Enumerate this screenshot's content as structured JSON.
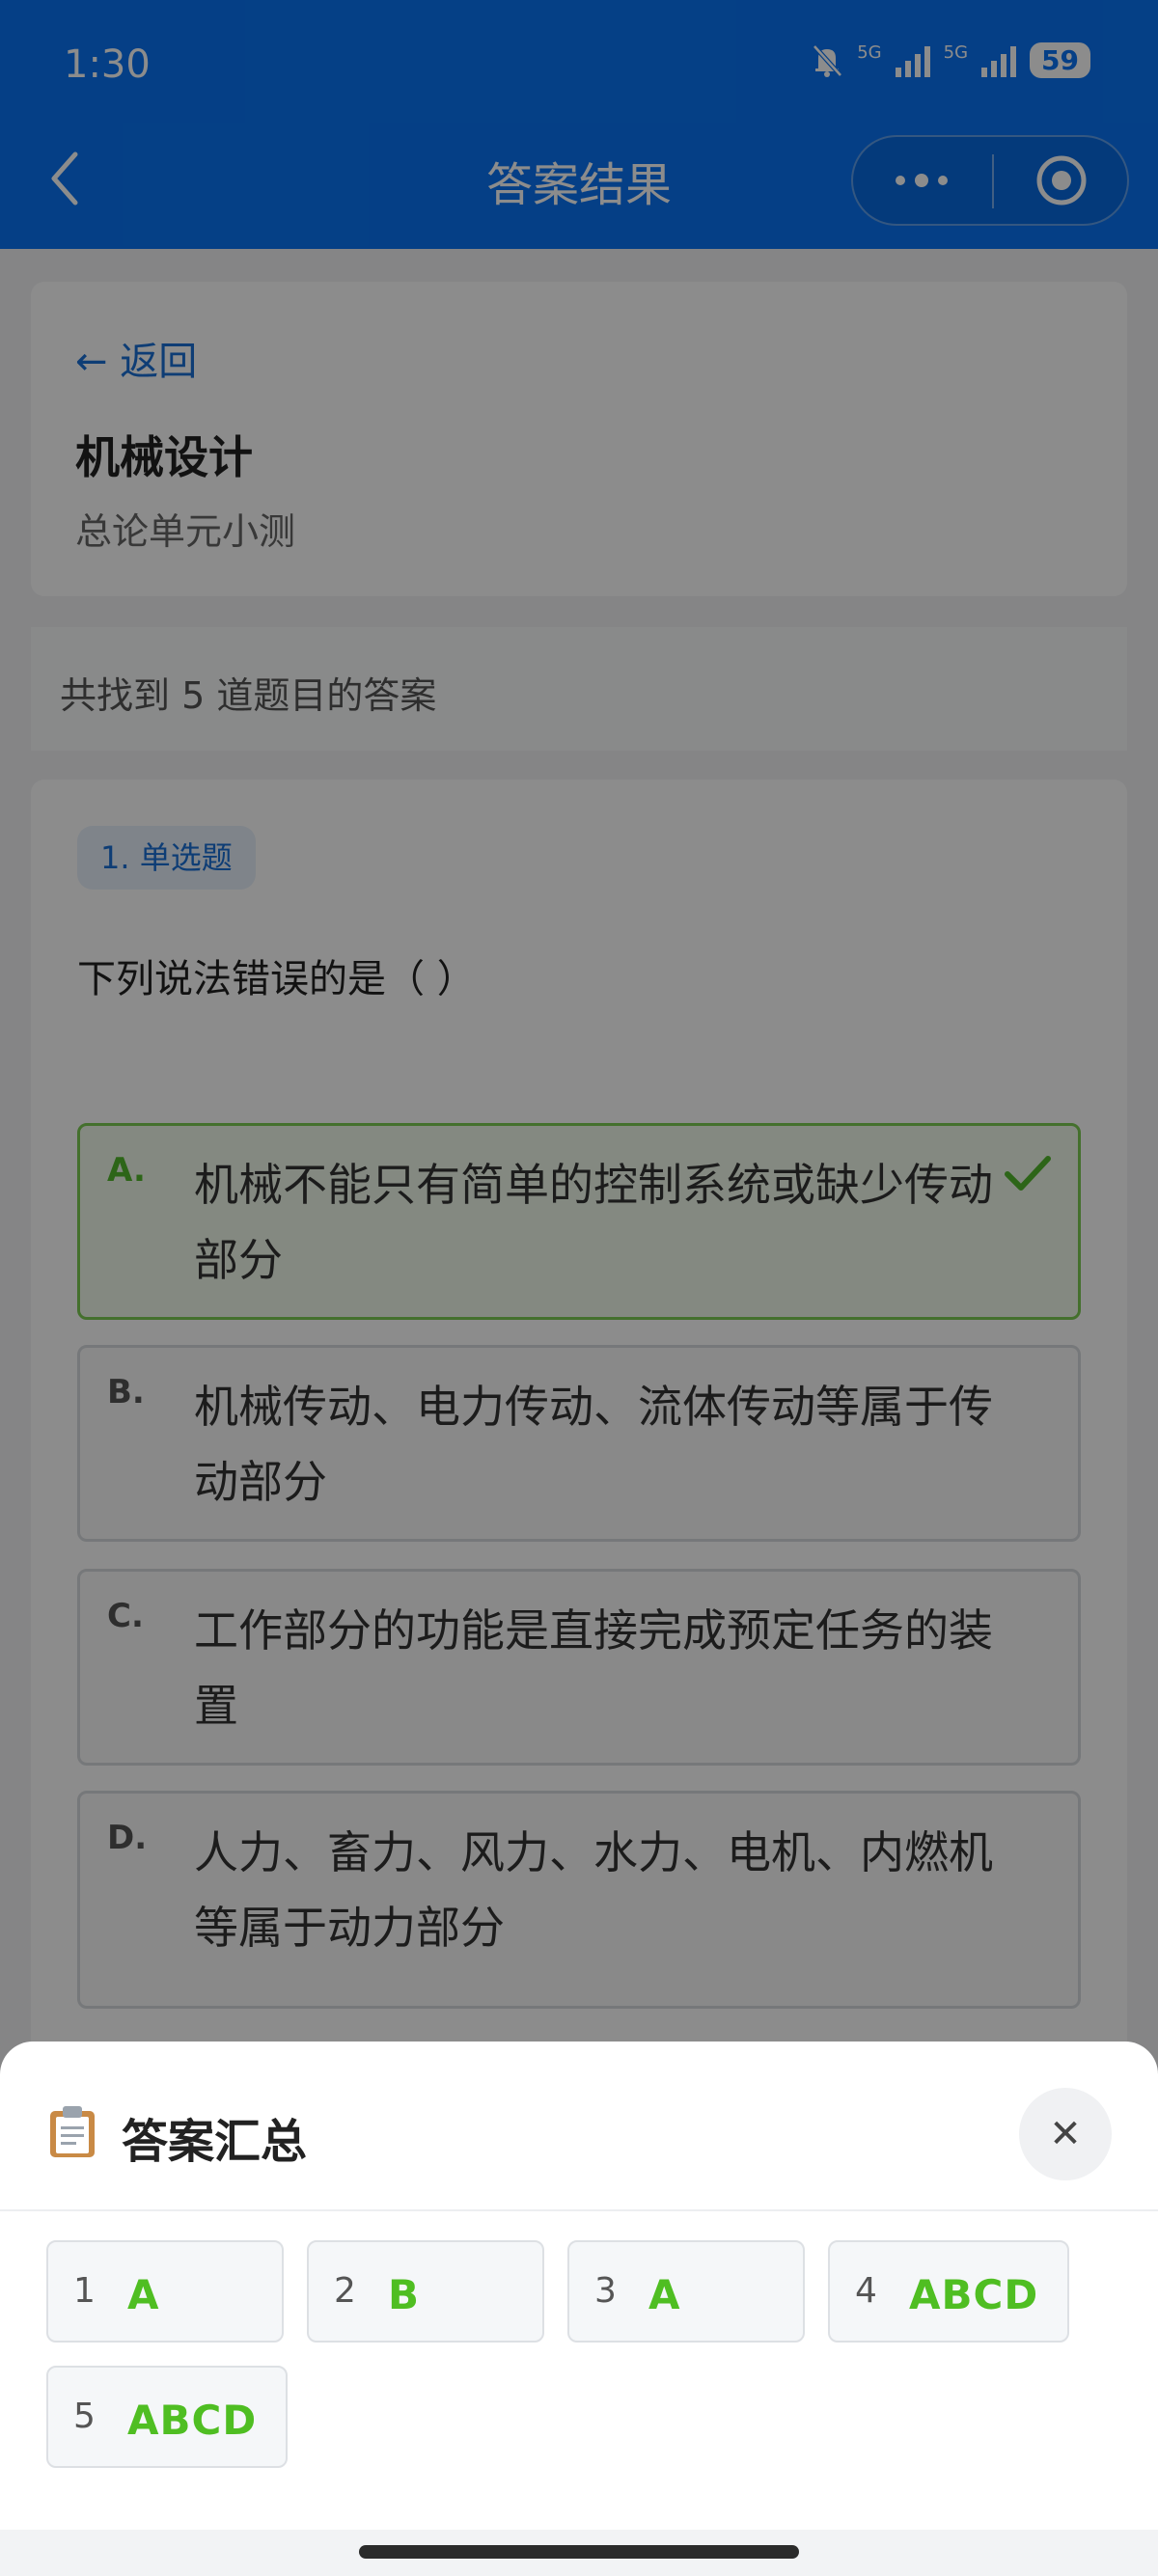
{
  "status": {
    "time": "1:30",
    "network1": "5G",
    "network2": "5G",
    "battery": "59"
  },
  "nav": {
    "title": "答案结果"
  },
  "header": {
    "back_label": "← 返回",
    "course_title": "机械设计",
    "course_subtitle": "总论单元小测"
  },
  "summary": {
    "count_text": "共找到 5 道题目的答案"
  },
  "question": {
    "badge": "1. 单选题",
    "text": "下列说法错误的是（    ）",
    "options": [
      {
        "letter": "A.",
        "text": "机械不能只有简单的控制系统或缺少传动部分",
        "correct": true
      },
      {
        "letter": "B.",
        "text": "机械传动、电力传动、流体传动等属于传动部分",
        "correct": false
      },
      {
        "letter": "C.",
        "text": "工作部分的功能是直接完成预定任务的装置",
        "correct": false
      },
      {
        "letter": "D.",
        "text": "人力、畜力、风力、水力、电机、内燃机等属于动力部分",
        "correct": false
      }
    ]
  },
  "sheet": {
    "icon": "clipboard-icon",
    "title": "答案汇总",
    "close_label": "✕",
    "answers": [
      {
        "num": "1",
        "value": "A"
      },
      {
        "num": "2",
        "value": "B"
      },
      {
        "num": "3",
        "value": "A"
      },
      {
        "num": "4",
        "value": "ABCD"
      },
      {
        "num": "5",
        "value": "ABCD"
      }
    ]
  },
  "colors": {
    "primary": "#0a74f4",
    "correct": "#52b82c",
    "link": "#1a6fd6"
  }
}
